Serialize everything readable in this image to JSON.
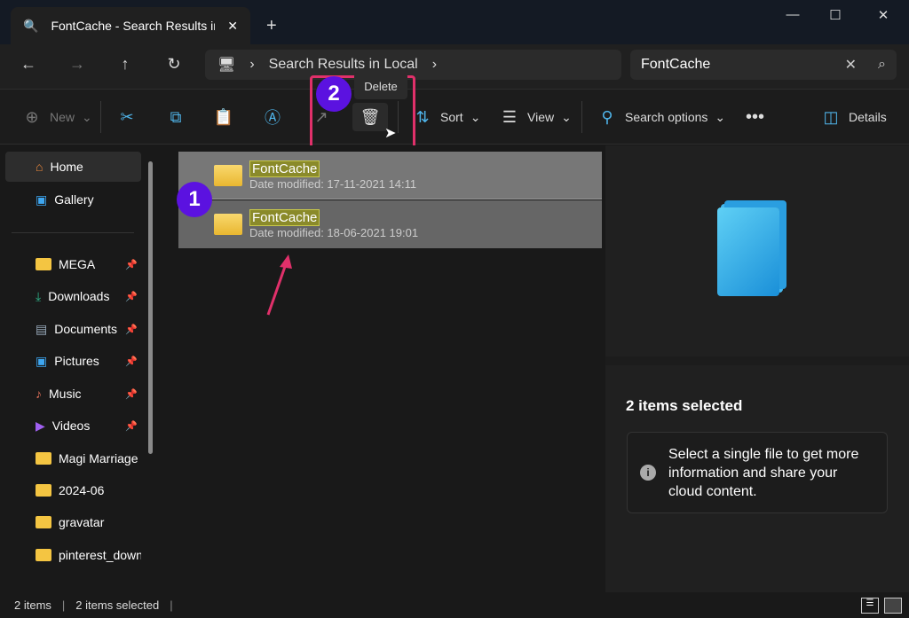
{
  "tab": {
    "title": "FontCache - Search Results in",
    "icon": "search-icon"
  },
  "address": {
    "crumb": "Search Results in Local"
  },
  "search": {
    "value": "FontCache"
  },
  "toolbar": {
    "new": "New",
    "sort": "Sort",
    "view": "View",
    "search_options": "Search options",
    "details": "Details",
    "tooltip": "Delete"
  },
  "annotations": {
    "step1": "1",
    "step2": "2",
    "accent": "#e0306a",
    "badge": "#5b12e0"
  },
  "sidebar": {
    "items": [
      {
        "label": "Home",
        "icon": "home-icon"
      },
      {
        "label": "Gallery",
        "icon": "gallery-icon"
      },
      {
        "label": "MEGA",
        "icon": "folder-icon",
        "pinned": true
      },
      {
        "label": "Downloads",
        "icon": "download-icon",
        "pinned": true
      },
      {
        "label": "Documents",
        "icon": "documents-icon",
        "pinned": true
      },
      {
        "label": "Pictures",
        "icon": "pictures-icon",
        "pinned": true
      },
      {
        "label": "Music",
        "icon": "music-icon",
        "pinned": true
      },
      {
        "label": "Videos",
        "icon": "videos-icon",
        "pinned": true
      },
      {
        "label": "Magi Marriage S",
        "icon": "folder-icon"
      },
      {
        "label": "2024-06",
        "icon": "folder-icon"
      },
      {
        "label": "gravatar",
        "icon": "folder-icon"
      },
      {
        "label": "pinterest_downl",
        "icon": "folder-icon"
      }
    ]
  },
  "files": [
    {
      "name": "FontCache",
      "date": "Date modified: 17-11-2021 14:11"
    },
    {
      "name": "FontCache",
      "date": "Date modified: 18-06-2021 19:01"
    }
  ],
  "details": {
    "title": "2 items selected",
    "info": "Select a single file to get more information and share your cloud content."
  },
  "status": {
    "count": "2 items",
    "selected": "2 items selected"
  }
}
